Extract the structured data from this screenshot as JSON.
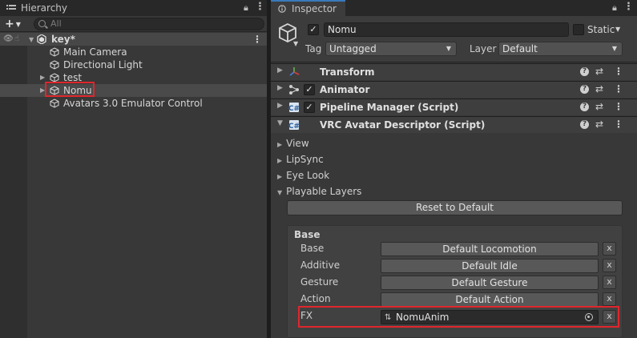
{
  "hierarchy": {
    "tab_title": "Hierarchy",
    "toolbar": {
      "add_label": "+",
      "search_placeholder": "All"
    },
    "scene": {
      "name": "key*"
    },
    "items": [
      {
        "label": "Main Camera"
      },
      {
        "label": "Directional Light"
      },
      {
        "label": "test"
      },
      {
        "label": "Nomu"
      },
      {
        "label": "Avatars 3.0 Emulator Control"
      }
    ]
  },
  "inspector": {
    "tab_title": "Inspector",
    "object": {
      "active": true,
      "name": "Nomu",
      "static_label": "Static",
      "tag_label": "Tag",
      "tag_value": "Untagged",
      "layer_label": "Layer",
      "layer_value": "Default"
    },
    "components": [
      {
        "title": "Transform",
        "has_checkbox": false
      },
      {
        "title": "Animator",
        "has_checkbox": true
      },
      {
        "title": "Pipeline Manager (Script)",
        "has_checkbox": true
      },
      {
        "title": "VRC Avatar Descriptor (Script)",
        "has_checkbox": false
      }
    ],
    "descriptor": {
      "foldouts": [
        "View",
        "LipSync",
        "Eye Look",
        "Playable Layers"
      ],
      "reset_button": "Reset to Default",
      "base_title": "Base",
      "layers": [
        {
          "label": "Base",
          "value": "Default Locomotion"
        },
        {
          "label": "Additive",
          "value": "Default Idle"
        },
        {
          "label": "Gesture",
          "value": "Default Gesture"
        },
        {
          "label": "Action",
          "value": "Default Action"
        },
        {
          "label": "FX",
          "value": "NomuAnim"
        }
      ],
      "clear_label": "x"
    }
  },
  "colors": {
    "highlight": "#e0262d",
    "tab_accent": "#3a79bb",
    "panel_bg": "#383838"
  }
}
